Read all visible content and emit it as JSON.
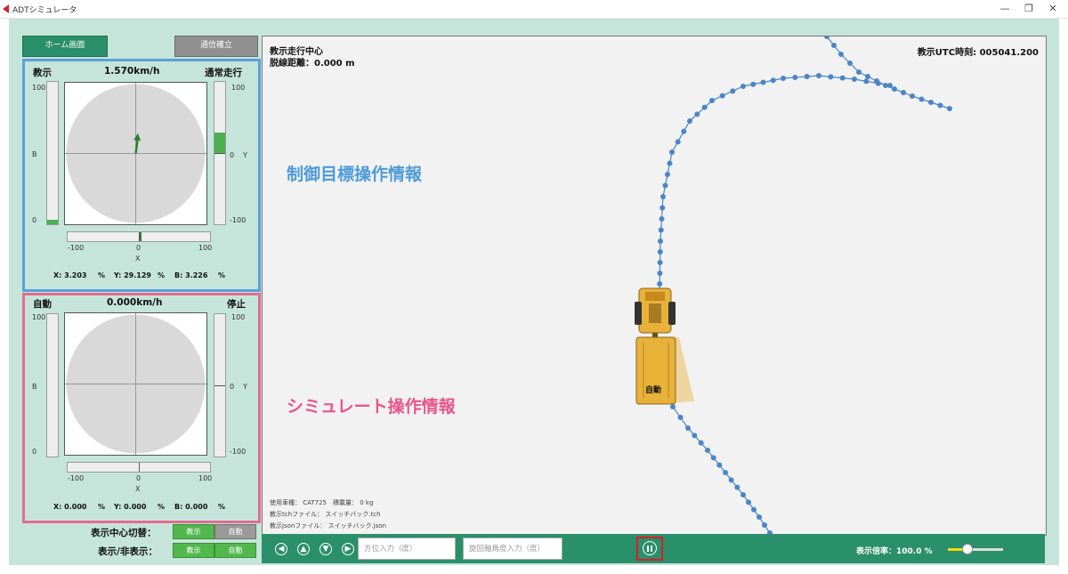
{
  "window": {
    "title": "ADTシミュレータ",
    "min": "—",
    "restore": "❐",
    "close": "✕"
  },
  "header": {
    "home_btn": "ホーム画面",
    "comm_btn": "通信確立"
  },
  "control_panel": {
    "left_label": "教示",
    "speed": "1.570km/h",
    "right_label": "通常走行",
    "left_ticks": [
      "100",
      "B",
      "0"
    ],
    "right_ticks": [
      "100",
      "0",
      "-100"
    ],
    "right_axis": "Y",
    "x_ticks": [
      "-100",
      "0",
      "100"
    ],
    "x_axis": "X",
    "stats": {
      "x": "X:  3.203",
      "y": "Y: 29.129",
      "b": "B:  3.226",
      "unit": "%"
    },
    "joystick": {
      "x": 3.203,
      "y": 29.129
    },
    "brake_level": 3.226
  },
  "sim_panel": {
    "left_label": "自動",
    "speed": "0.000km/h",
    "right_label": "停止",
    "left_ticks": [
      "100",
      "B",
      "0"
    ],
    "right_ticks": [
      "100",
      "0",
      "-100"
    ],
    "right_axis": "Y",
    "x_ticks": [
      "-100",
      "0",
      "100"
    ],
    "x_axis": "X",
    "stats": {
      "x": "X:  0.000",
      "y": "Y:  0.000",
      "b": "B:  0.000",
      "unit": "%"
    }
  },
  "annotations": {
    "control": "制御目標操作情報",
    "sim": "シミュレート操作情報"
  },
  "map": {
    "mode": "教示走行中心",
    "distance": "脱線距離：0.000 m",
    "utc": "教示UTC時刻: 005041.200",
    "vehicle_label": "自動",
    "info": {
      "vehicle": "使用車種：  CAT725　積載量：  0 kg",
      "tch": "教示tchファイル：  スイッチバック.tch",
      "json": "教示jsonファイル：  スイッチバック.json"
    },
    "path_color": "#4a86c6",
    "vehicle_color": "#e8b13a"
  },
  "bottom_bar": {
    "arrows": [
      "◀",
      "▲",
      "▼",
      "▶"
    ],
    "heading_placeholder": "方位入力（度）",
    "turn_placeholder": "旋回軸角度入力（度）",
    "zoom_label": "表示倍率：100.0 %",
    "zoom_level": 0.35
  },
  "bottom_controls": {
    "center_label": "表示中心切替：",
    "show_label": "表示/非表示：",
    "teach_btn": "教示",
    "auto_btn": "自動"
  }
}
